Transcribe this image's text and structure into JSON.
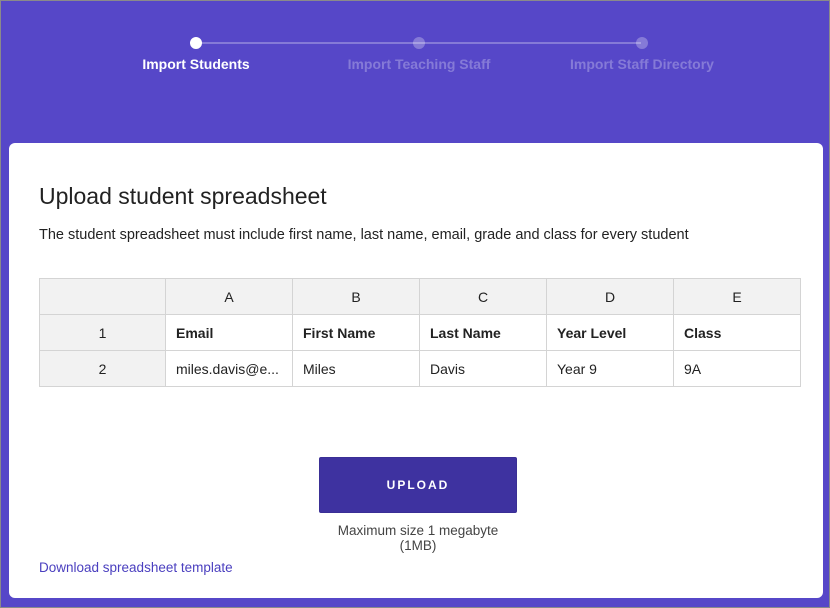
{
  "stepper": {
    "steps": [
      {
        "label": "Import Students",
        "state": "active"
      },
      {
        "label": "Import Teaching Staff",
        "state": "inactive"
      },
      {
        "label": "Import Staff Directory",
        "state": "inactive"
      }
    ]
  },
  "card": {
    "title": "Upload student spreadsheet",
    "description": "The student spreadsheet must include first name, last name, email, grade and class for every student"
  },
  "sheet": {
    "columns": [
      "A",
      "B",
      "C",
      "D",
      "E"
    ],
    "rows": [
      {
        "num": "1",
        "cells": [
          "Email",
          "First Name",
          "Last Name",
          "Year Level",
          "Class"
        ]
      },
      {
        "num": "2",
        "cells": [
          "miles.davis@e...",
          "Miles",
          "Davis",
          "Year 9",
          "9A"
        ]
      }
    ]
  },
  "upload": {
    "button_label": "UPLOAD",
    "max_size_text": "Maximum size 1 megabyte (1MB)"
  },
  "download_link": "Download spreadsheet template",
  "colors": {
    "background": "#5647c8",
    "button": "#3e32a0",
    "link": "#4a3fbf"
  }
}
